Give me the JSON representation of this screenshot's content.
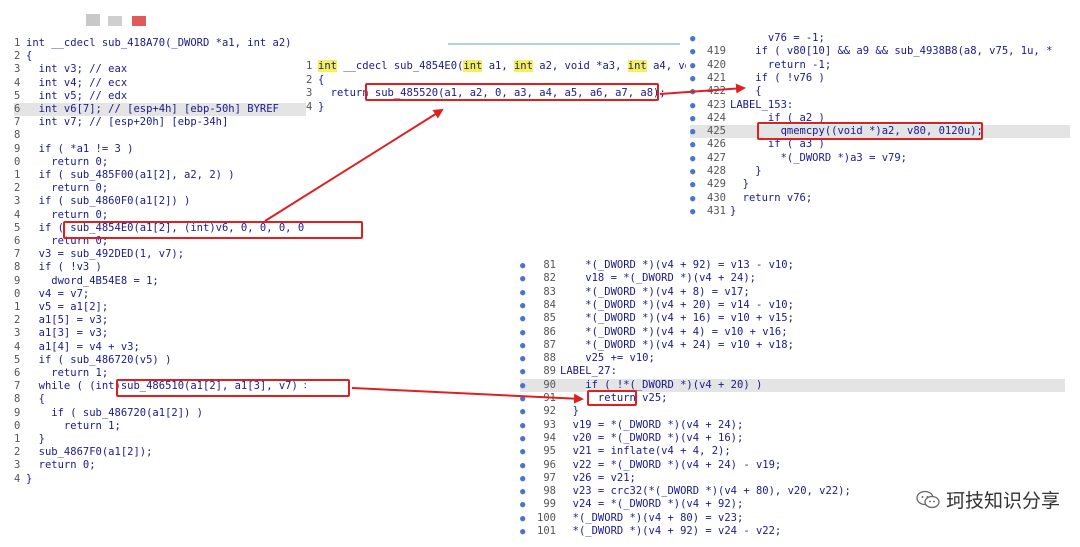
{
  "left_panel": {
    "lines": [
      {
        "ln": "1",
        "code": "int __cdecl sub_418A70(_DWORD *a1, int a2)"
      },
      {
        "ln": "2",
        "code": "{"
      },
      {
        "ln": "3",
        "code": "  int v3; // eax"
      },
      {
        "ln": "4",
        "code": "  int v4; // ecx"
      },
      {
        "ln": "5",
        "code": "  int v5; // edx"
      },
      {
        "ln": "6",
        "code": "  int v6[7]; // [esp+4h] [ebp-50h] BYREF",
        "hl": true
      },
      {
        "ln": "7",
        "code": "  int v7; // [esp+20h] [ebp-34h]"
      },
      {
        "ln": "8",
        "code": ""
      },
      {
        "ln": "9",
        "code": "  if ( *a1 != 3 )"
      },
      {
        "ln": "0",
        "code": "    return 0;"
      },
      {
        "ln": "1",
        "code": "  if ( sub_485F00(a1[2], a2, 2) )"
      },
      {
        "ln": "2",
        "code": "    return 0;"
      },
      {
        "ln": "3",
        "code": "  if ( sub_4860F0(a1[2]) )"
      },
      {
        "ln": "4",
        "code": "    return 0;"
      },
      {
        "ln": "5",
        "code": "  if ( sub_4854E0(a1[2], (int)v6, 0, 0, 0, 0, 0, 0) )"
      },
      {
        "ln": "6",
        "code": "    return 0;"
      },
      {
        "ln": "7",
        "code": "  v3 = sub_492DED(1, v7);"
      },
      {
        "ln": "8",
        "code": "  if ( !v3 )"
      },
      {
        "ln": "9",
        "code": "    dword_4B54E8 = 1;"
      },
      {
        "ln": "0",
        "code": "  v4 = v7;"
      },
      {
        "ln": "1",
        "code": "  v5 = a1[2];"
      },
      {
        "ln": "2",
        "code": "  a1[5] = v3;"
      },
      {
        "ln": "3",
        "code": "  a1[3] = v3;"
      },
      {
        "ln": "4",
        "code": "  a1[4] = v4 + v3;"
      },
      {
        "ln": "5",
        "code": "  if ( sub_486720(v5) )"
      },
      {
        "ln": "6",
        "code": "    return 1;"
      },
      {
        "ln": "7",
        "code": "  while ( (int)sub_486510(a1[2], a1[3], v7) >= 0 )"
      },
      {
        "ln": "8",
        "code": "  {"
      },
      {
        "ln": "9",
        "code": "    if ( sub_486720(a1[2]) )"
      },
      {
        "ln": "0",
        "code": "      return 1;"
      },
      {
        "ln": "1",
        "code": "  }"
      },
      {
        "ln": "2",
        "code": "  sub_4867F0(a1[2]);"
      },
      {
        "ln": "3",
        "code": "  return 0;"
      },
      {
        "ln": "4",
        "code": "}"
      }
    ]
  },
  "mid_panel": {
    "lines": [
      {
        "ln": "1",
        "code": "int __cdecl sub_4854E0(int a1, int a2, void *a3, int a4, voi"
      },
      {
        "ln": "2",
        "code": "{"
      },
      {
        "ln": "3",
        "code": "  return sub_485520(a1, a2, 0, a3, a4, a5, a6, a7, a8);"
      },
      {
        "ln": "4",
        "code": "}"
      }
    ]
  },
  "right_top_panel": {
    "lines": [
      {
        "ln": "",
        "code": "      v76 = -1;"
      },
      {
        "ln": "419",
        "code": "    if ( v80[10] && a9 && sub_4938B8(a8, v75, 1u, *"
      },
      {
        "ln": "420",
        "code": "      return -1;"
      },
      {
        "ln": "421",
        "code": "    if ( !v76 )"
      },
      {
        "ln": "422",
        "code": "    {"
      },
      {
        "ln": "423",
        "code": "LABEL_153:"
      },
      {
        "ln": "424",
        "code": "      if ( a2 )"
      },
      {
        "ln": "425",
        "code": "        qmemcpy((void *)a2, v80, 0120u);",
        "hl": true
      },
      {
        "ln": "426",
        "code": "      if ( a3 )"
      },
      {
        "ln": "427",
        "code": "        *(_DWORD *)a3 = v79;"
      },
      {
        "ln": "428",
        "code": "    }"
      },
      {
        "ln": "429",
        "code": "  }"
      },
      {
        "ln": "430",
        "code": "  return v76;"
      },
      {
        "ln": "431",
        "code": "}"
      }
    ]
  },
  "right_bottom_panel": {
    "lines": [
      {
        "ln": "81",
        "code": "    *(_DWORD *)(v4 + 92) = v13 - v10;"
      },
      {
        "ln": "82",
        "code": "    v18 = *(_DWORD *)(v4 + 24);"
      },
      {
        "ln": "83",
        "code": "    *(_DWORD *)(v4 + 8) = v17;"
      },
      {
        "ln": "84",
        "code": "    *(_DWORD *)(v4 + 20) = v14 - v10;"
      },
      {
        "ln": "85",
        "code": "    *(_DWORD *)(v4 + 16) = v10 + v15;"
      },
      {
        "ln": "86",
        "code": "    *(_DWORD *)(v4 + 4) = v10 + v16;"
      },
      {
        "ln": "87",
        "code": "    *(_DWORD *)(v4 + 24) = v10 + v18;"
      },
      {
        "ln": "88",
        "code": "    v25 += v10;"
      },
      {
        "ln": "89",
        "code": "LABEL_27:"
      },
      {
        "ln": "90",
        "code": "    if ( !*(_DWORD *)(v4 + 20) )",
        "hl": true
      },
      {
        "ln": "91",
        "code": "      return v25;"
      },
      {
        "ln": "92",
        "code": "  }"
      },
      {
        "ln": "93",
        "code": "  v19 = *(_DWORD *)(v4 + 24);"
      },
      {
        "ln": "94",
        "code": "  v20 = *(_DWORD *)(v4 + 16);"
      },
      {
        "ln": "95",
        "code": "  v21 = inflate(v4 + 4, 2);"
      },
      {
        "ln": "96",
        "code": "  v22 = *(_DWORD *)(v4 + 24) - v19;"
      },
      {
        "ln": "97",
        "code": "  v26 = v21;"
      },
      {
        "ln": "98",
        "code": "  v23 = crc32(*(_DWORD *)(v4 + 80), v20, v22);"
      },
      {
        "ln": "99",
        "code": "  v24 = *(_DWORD *)(v4 + 92);"
      },
      {
        "ln": "100",
        "code": "  *(_DWORD *)(v4 + 80) = v23;"
      },
      {
        "ln": "101",
        "code": "  *(_DWORD *)(v4 + 92) = v24 - v22;"
      }
    ]
  },
  "watermark": {
    "text": "珂技知识分享"
  },
  "colors": {
    "highlight_box": "#e02020",
    "code": "#1a1a8c",
    "keyword_bg": "#f5f055",
    "line_hl": "#e4e4e4"
  }
}
